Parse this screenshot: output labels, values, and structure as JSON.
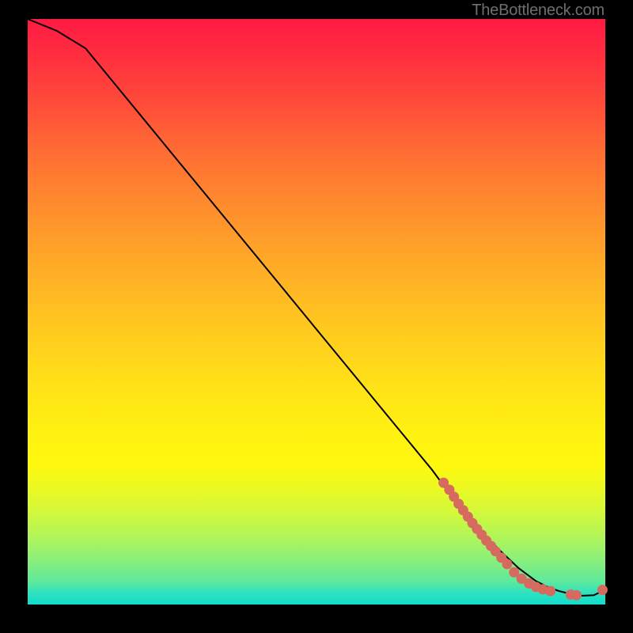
{
  "watermark": "TheBottleneck.com",
  "chart_data": {
    "type": "line",
    "title": "",
    "xlabel": "",
    "ylabel": "",
    "xlim": [
      0,
      100
    ],
    "ylim": [
      0,
      100
    ],
    "curve": {
      "name": "curve",
      "x": [
        0,
        5,
        10,
        15,
        20,
        25,
        30,
        35,
        40,
        45,
        50,
        55,
        60,
        65,
        70,
        73,
        76,
        79,
        82,
        85,
        88,
        90,
        92,
        94,
        96,
        98,
        100
      ],
      "y": [
        100,
        98,
        95,
        89,
        83,
        77,
        71,
        65,
        59,
        53,
        47,
        41,
        35,
        29,
        23,
        19,
        15.5,
        12,
        9,
        6.2,
        4.0,
        3.0,
        2.3,
        1.8,
        1.5,
        1.6,
        2.5
      ]
    },
    "scatter": {
      "name": "points",
      "color": "#d66a5f",
      "x": [
        72,
        73,
        73.8,
        74.6,
        75.4,
        76.2,
        77,
        77.8,
        78.6,
        79.4,
        80.2,
        81,
        82,
        83,
        84.2,
        85.5,
        86.8,
        88,
        89.2,
        90.5,
        94,
        95,
        99.5
      ],
      "y": [
        20.8,
        19.6,
        18.4,
        17.2,
        16.1,
        15.0,
        13.9,
        12.9,
        11.9,
        10.9,
        10.0,
        9.1,
        8.0,
        6.9,
        5.5,
        4.4,
        3.6,
        3.0,
        2.6,
        2.3,
        1.7,
        1.6,
        2.5
      ]
    }
  }
}
